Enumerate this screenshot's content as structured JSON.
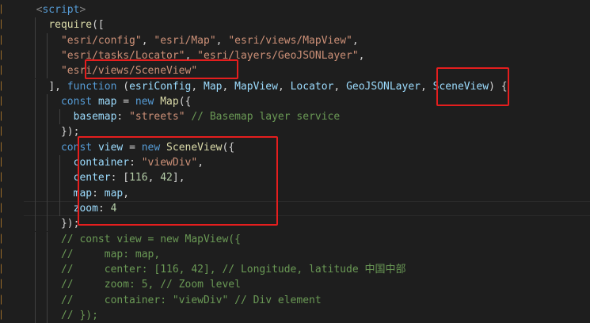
{
  "editor": {
    "accent_color": "#e51e1e",
    "lines": [
      {
        "indent": 2,
        "tokens": [
          {
            "c": "tagpun",
            "t": "<"
          },
          {
            "c": "tag",
            "t": "script"
          },
          {
            "c": "tagpun",
            "t": ">"
          }
        ]
      },
      {
        "indent": 4,
        "tokens": [
          {
            "c": "fn",
            "t": "require"
          },
          {
            "c": "pun",
            "t": "(["
          }
        ]
      },
      {
        "indent": 6,
        "tokens": [
          {
            "c": "str",
            "t": "\"esri/config\""
          },
          {
            "c": "pun",
            "t": ", "
          },
          {
            "c": "str",
            "t": "\"esri/Map\""
          },
          {
            "c": "pun",
            "t": ", "
          },
          {
            "c": "str",
            "t": "\"esri/views/MapView\""
          },
          {
            "c": "pun",
            "t": ","
          }
        ]
      },
      {
        "indent": 6,
        "tokens": [
          {
            "c": "str",
            "t": "\"esri/tasks/Locator\""
          },
          {
            "c": "pun",
            "t": ", "
          },
          {
            "c": "str",
            "t": "\"esri/layers/GeoJSONLayer\""
          },
          {
            "c": "pun",
            "t": ","
          }
        ]
      },
      {
        "indent": 6,
        "tokens": [
          {
            "c": "str",
            "t": "\"esri/views/SceneView\""
          }
        ]
      },
      {
        "indent": 4,
        "tokens": [
          {
            "c": "pun",
            "t": "], "
          },
          {
            "c": "kw",
            "t": "function"
          },
          {
            "c": "pun",
            "t": " ("
          },
          {
            "c": "var",
            "t": "esriConfig"
          },
          {
            "c": "pun",
            "t": ", "
          },
          {
            "c": "var",
            "t": "Map"
          },
          {
            "c": "pun",
            "t": ", "
          },
          {
            "c": "var",
            "t": "MapView"
          },
          {
            "c": "pun",
            "t": ", "
          },
          {
            "c": "var",
            "t": "Locator"
          },
          {
            "c": "pun",
            "t": ", "
          },
          {
            "c": "var",
            "t": "GeoJSONLayer"
          },
          {
            "c": "pun",
            "t": ", "
          },
          {
            "c": "var",
            "t": "SceneView"
          },
          {
            "c": "pun",
            "t": ") {"
          }
        ]
      },
      {
        "indent": 6,
        "tokens": [
          {
            "c": "kw",
            "t": "const"
          },
          {
            "c": "pun",
            "t": " "
          },
          {
            "c": "var",
            "t": "map"
          },
          {
            "c": "pun",
            "t": " = "
          },
          {
            "c": "kw",
            "t": "new"
          },
          {
            "c": "pun",
            "t": " "
          },
          {
            "c": "fn",
            "t": "Map"
          },
          {
            "c": "pun",
            "t": "({"
          }
        ]
      },
      {
        "indent": 8,
        "tokens": [
          {
            "c": "prop",
            "t": "basemap"
          },
          {
            "c": "pun",
            "t": ": "
          },
          {
            "c": "str",
            "t": "\"streets\""
          },
          {
            "c": "pun",
            "t": " "
          },
          {
            "c": "com",
            "t": "// Basemap layer service"
          }
        ]
      },
      {
        "indent": 6,
        "tokens": [
          {
            "c": "pun",
            "t": "});"
          }
        ]
      },
      {
        "indent": 6,
        "tokens": [
          {
            "c": "kw",
            "t": "const"
          },
          {
            "c": "pun",
            "t": " "
          },
          {
            "c": "var",
            "t": "view"
          },
          {
            "c": "pun",
            "t": " = "
          },
          {
            "c": "kw",
            "t": "new"
          },
          {
            "c": "pun",
            "t": " "
          },
          {
            "c": "fn",
            "t": "SceneView"
          },
          {
            "c": "pun",
            "t": "({"
          }
        ]
      },
      {
        "indent": 8,
        "tokens": [
          {
            "c": "prop",
            "t": "container"
          },
          {
            "c": "pun",
            "t": ": "
          },
          {
            "c": "str",
            "t": "\"viewDiv\""
          },
          {
            "c": "pun",
            "t": ","
          }
        ]
      },
      {
        "indent": 8,
        "tokens": [
          {
            "c": "prop",
            "t": "center"
          },
          {
            "c": "pun",
            "t": ": ["
          },
          {
            "c": "num",
            "t": "116"
          },
          {
            "c": "pun",
            "t": ", "
          },
          {
            "c": "num",
            "t": "42"
          },
          {
            "c": "pun",
            "t": "],"
          }
        ]
      },
      {
        "indent": 8,
        "tokens": [
          {
            "c": "prop",
            "t": "map"
          },
          {
            "c": "pun",
            "t": ": "
          },
          {
            "c": "var",
            "t": "map"
          },
          {
            "c": "pun",
            "t": ","
          }
        ]
      },
      {
        "indent": 8,
        "tokens": [
          {
            "c": "prop",
            "t": "zoom"
          },
          {
            "c": "pun",
            "t": ": "
          },
          {
            "c": "num",
            "t": "4"
          }
        ]
      },
      {
        "indent": 6,
        "tokens": [
          {
            "c": "pun",
            "t": "});"
          }
        ]
      },
      {
        "indent": 6,
        "tokens": [
          {
            "c": "com",
            "t": "// const view = new MapView({"
          }
        ]
      },
      {
        "indent": 6,
        "tokens": [
          {
            "c": "com",
            "t": "//     map: map,"
          }
        ]
      },
      {
        "indent": 6,
        "tokens": [
          {
            "c": "com",
            "t": "//     center: [116, 42], // Longitude, latitude 中国中部"
          }
        ]
      },
      {
        "indent": 6,
        "tokens": [
          {
            "c": "com",
            "t": "//     zoom: 5, // Zoom level"
          }
        ]
      },
      {
        "indent": 6,
        "tokens": [
          {
            "c": "com",
            "t": "//     container: \"viewDiv\" // Div element"
          }
        ]
      },
      {
        "indent": 6,
        "tokens": [
          {
            "c": "com",
            "t": "// });"
          }
        ]
      }
    ]
  }
}
